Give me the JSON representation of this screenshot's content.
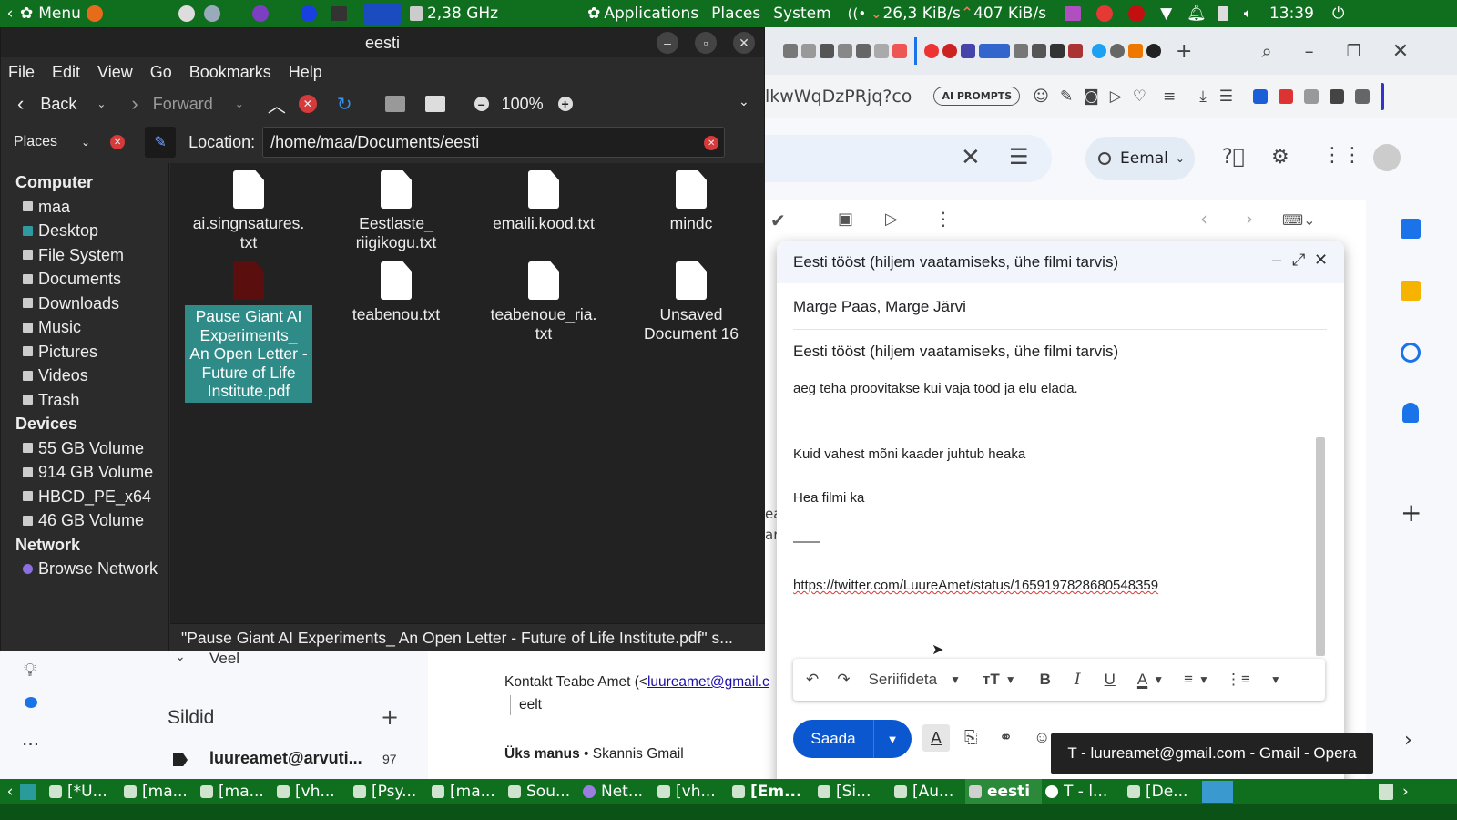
{
  "top_panel": {
    "menu_label": "Menu",
    "cpu_freq": "2,38 GHz",
    "applications": "Applications",
    "places": "Places",
    "system": "System",
    "net_down": "26,3 KiB/s",
    "net_up": "407 KiB/s",
    "clock": "13:39"
  },
  "browser": {
    "address_fragment": "lkwWqDzPRjq?co",
    "ai_prompts": "AI PROMPTS",
    "search_scope": "Eemal",
    "sidebar_more": "Veel",
    "labels_title": "Sildid",
    "label_item": "luureamet@arvuti...",
    "label_count": "97",
    "preview_contact": "Kontakt Teabe Amet (<",
    "preview_email": "luureamet@gmail.c",
    "preview_text2": "eelt",
    "preview_attach": "Üks manus",
    "preview_attach2": "• Skannis Gmail",
    "tooltip": "T - luureamet@gmail.com - Gmail - Opera"
  },
  "compose": {
    "title": "Eesti tööst (hiljem vaatamiseks, ühe filmi tarvis)",
    "to": "Marge Paas, Marge Järvi",
    "subject": "Eesti tööst (hiljem vaatamiseks, ühe filmi tarvis)",
    "body_line1": "aeg teha proovitakse kui vaja tööd ja elu elada.",
    "body_line2": "Kuid vahest mõni kaader juhtub heaka",
    "body_line3": "Hea filmi ka",
    "signature_dash": "——",
    "link": "https://twitter.com/LuureAmet/status/1659197828680548359",
    "font_name": "Seriifideta",
    "send_label": "Saada"
  },
  "file_manager": {
    "title": "eesti",
    "menu": [
      "File",
      "Edit",
      "View",
      "Go",
      "Bookmarks",
      "Help"
    ],
    "back": "Back",
    "forward": "Forward",
    "zoom": "100%",
    "places_label": "Places",
    "location_label": "Location:",
    "location_path": "/home/maa/Documents/eesti",
    "sidebar": {
      "computer_header": "Computer",
      "computer_items": [
        "maa",
        "Desktop",
        "File System",
        "Documents",
        "Downloads",
        "Music",
        "Pictures",
        "Videos",
        "Trash"
      ],
      "devices_header": "Devices",
      "device_items": [
        "55 GB Volume",
        "914 GB Volume",
        "HBCD_PE_x64",
        "46 GB Volume"
      ],
      "network_header": "Network",
      "network_items": [
        "Browse Network"
      ]
    },
    "files": [
      {
        "name": "ai.singnsatures.\ntxt",
        "type": "txt"
      },
      {
        "name": "Eestlaste_\nriigikogu.txt",
        "type": "txt"
      },
      {
        "name": "emaili.kood.txt",
        "type": "txt"
      },
      {
        "name": "mindc",
        "type": "txt"
      },
      {
        "name": "Pause Giant AI\nExperiments_\nAn Open Letter -\nFuture of Life\nInstitute.pdf",
        "type": "pdf"
      },
      {
        "name": "teabenou.txt",
        "type": "txt"
      },
      {
        "name": "teabenoue_ria.\ntxt",
        "type": "txt"
      },
      {
        "name": "Unsaved\nDocument 16",
        "type": "txt"
      }
    ],
    "status": "\"Pause Giant AI Experiments_ An Open Letter - Future of Life Institute.pdf\" s..."
  },
  "taskbar": {
    "items": [
      "[*U...",
      "[ma...",
      "[ma...",
      "[vh...",
      "[Psy...",
      "[ma...",
      "Sou...",
      "Net...",
      "[vh...",
      "[Em...",
      "[Si...",
      "[Au...",
      "eesti",
      "T - l...",
      "[De..."
    ]
  },
  "colors": {
    "panel_green": "#0f6f1f",
    "selection_teal": "#2e8b87",
    "gmail_blue": "#0b57d0"
  }
}
